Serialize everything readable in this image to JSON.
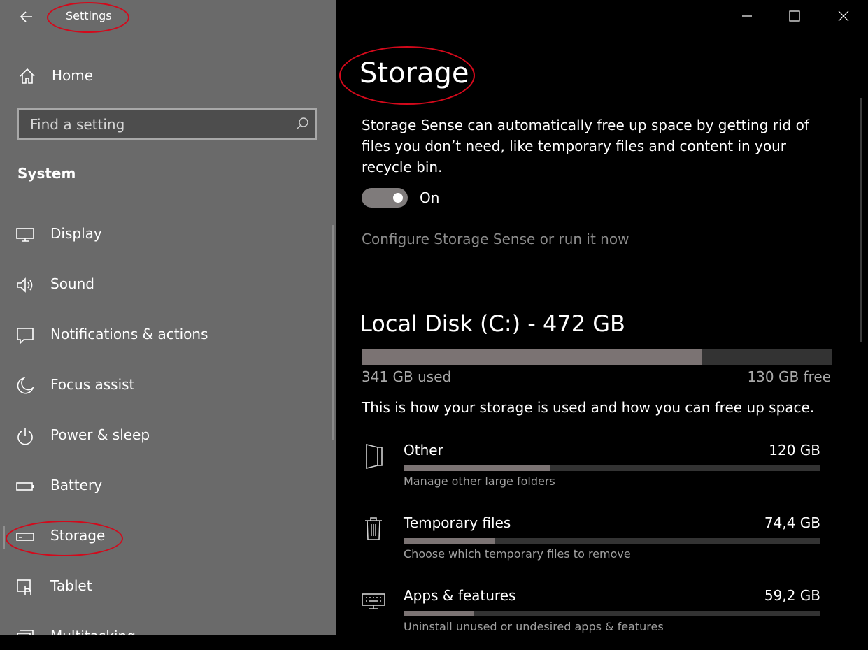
{
  "window": {
    "title": "Settings",
    "controls": {
      "minimize": "minimize-icon",
      "maximize": "maximize-icon",
      "close": "close-icon"
    }
  },
  "sidebar": {
    "home_label": "Home",
    "search": {
      "placeholder": "Find a setting",
      "value": ""
    },
    "section_title": "System",
    "items": [
      {
        "label": "Display",
        "icon": "display-icon"
      },
      {
        "label": "Sound",
        "icon": "speaker-icon"
      },
      {
        "label": "Notifications & actions",
        "icon": "notification-icon"
      },
      {
        "label": "Focus assist",
        "icon": "moon-icon"
      },
      {
        "label": "Power & sleep",
        "icon": "power-icon"
      },
      {
        "label": "Battery",
        "icon": "battery-icon"
      },
      {
        "label": "Storage",
        "icon": "storage-drive-icon",
        "selected": true
      },
      {
        "label": "Tablet",
        "icon": "tablet-icon"
      },
      {
        "label": "Multitasking",
        "icon": "multitasking-icon"
      }
    ]
  },
  "main": {
    "title": "Storage",
    "storage_sense": {
      "description": "Storage Sense can automatically free up space by getting rid of files you don’t need, like temporary files and content in your recycle bin.",
      "toggle_state": "On",
      "enabled": true,
      "configure_link": "Configure Storage Sense or run it now"
    },
    "disk": {
      "title": "Local Disk (C:) - 472 GB",
      "used_label": "341 GB used",
      "free_label": "130 GB free",
      "used_fraction": 0.7225
    },
    "usage_description": "This is how your storage is used and how you can free up space.",
    "categories": [
      {
        "name": "Other",
        "size": "120 GB",
        "hint": "Manage other large folders",
        "fraction": 0.35,
        "icon": "other-files-icon"
      },
      {
        "name": "Temporary files",
        "size": "74,4 GB",
        "hint": "Choose which temporary files to remove",
        "fraction": 0.22,
        "icon": "trash-icon"
      },
      {
        "name": "Apps & features",
        "size": "59,2 GB",
        "hint": "Uninstall unused or undesired apps & features",
        "fraction": 0.17,
        "icon": "keyboard-icon"
      }
    ]
  },
  "colors": {
    "annotation": "#d3091b",
    "sidebar_bg": "#6a6a6a",
    "main_bg": "#000000",
    "bar_fill": "#7b7373",
    "bar_track": "#333333"
  }
}
